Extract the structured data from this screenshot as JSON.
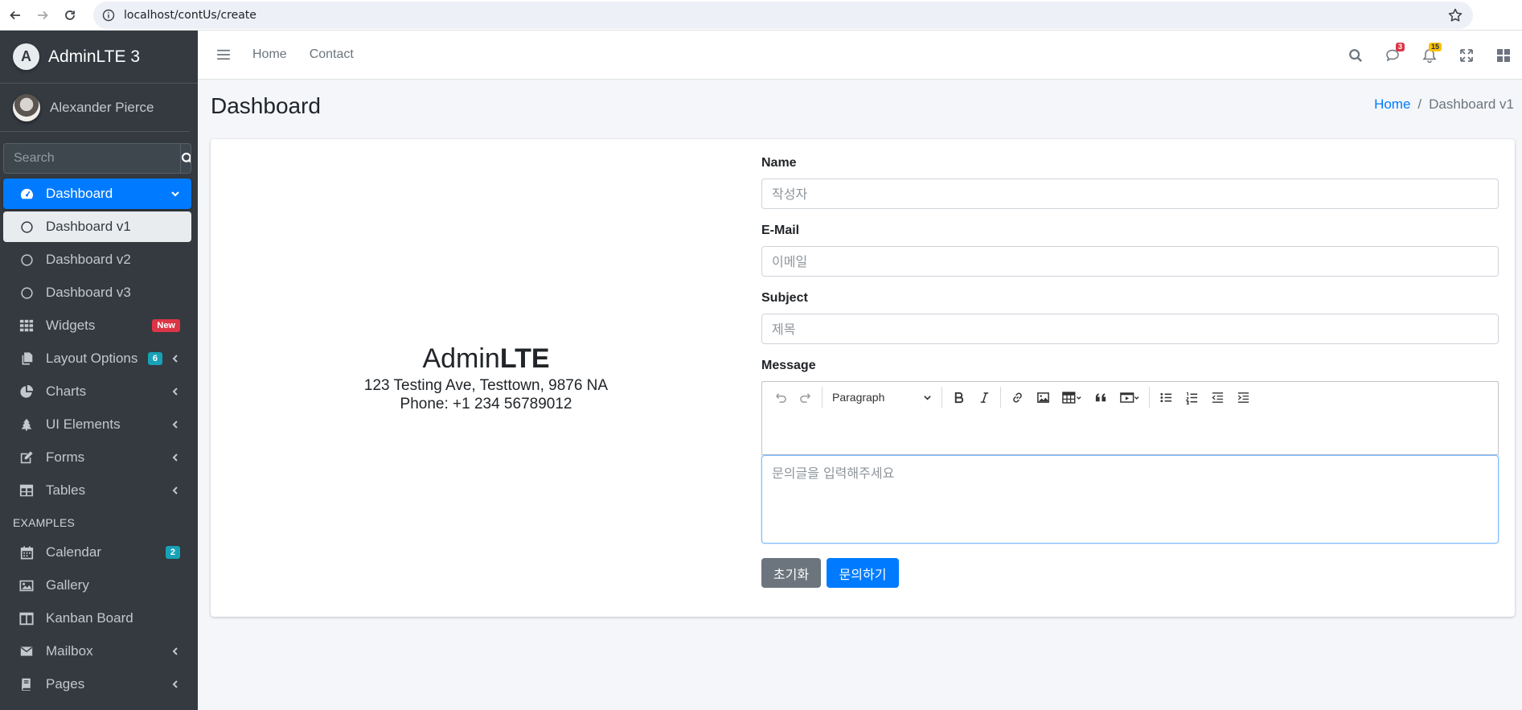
{
  "browser": {
    "url": "localhost/contUs/create"
  },
  "sidebar": {
    "brand": "AdminLTE 3",
    "brand_logo_letter": "A",
    "user_name": "Alexander Pierce",
    "search_placeholder": "Search",
    "items": [
      {
        "label": "Dashboard",
        "icon": "tachometer-icon",
        "state": "active"
      },
      {
        "label": "Dashboard v1",
        "icon": "circle-icon",
        "state": "sub-active"
      },
      {
        "label": "Dashboard v2",
        "icon": "circle-icon"
      },
      {
        "label": "Dashboard v3",
        "icon": "circle-icon"
      },
      {
        "label": "Widgets",
        "icon": "th-icon",
        "badge": "New"
      },
      {
        "label": "Layout Options",
        "icon": "copy-icon",
        "badge": "6"
      },
      {
        "label": "Charts",
        "icon": "chart-pie-icon"
      },
      {
        "label": "UI Elements",
        "icon": "tree-icon"
      },
      {
        "label": "Forms",
        "icon": "edit-icon"
      },
      {
        "label": "Tables",
        "icon": "table-icon"
      }
    ],
    "section_header": "EXAMPLES",
    "examples": [
      {
        "label": "Calendar",
        "icon": "calendar-icon",
        "badge": "2"
      },
      {
        "label": "Gallery",
        "icon": "image-icon"
      },
      {
        "label": "Kanban Board",
        "icon": "columns-icon"
      },
      {
        "label": "Mailbox",
        "icon": "envelope-icon"
      },
      {
        "label": "Pages",
        "icon": "book-icon"
      }
    ]
  },
  "navbar": {
    "links": [
      "Home",
      "Contact"
    ],
    "messages_count": "3",
    "notifications_count": "15"
  },
  "header": {
    "title": "Dashboard",
    "breadcrumb_home": "Home",
    "breadcrumb_sep": "/",
    "breadcrumb_current": "Dashboard v1"
  },
  "contact": {
    "company_light": "Admin",
    "company_bold": "LTE",
    "address": "123 Testing Ave, Testtown, 9876 NA",
    "phone": "Phone: +1 234 56789012"
  },
  "form": {
    "name_label": "Name",
    "name_placeholder": "작성자",
    "email_label": "E-Mail",
    "email_placeholder": "이메일",
    "subject_label": "Subject",
    "subject_placeholder": "제목",
    "message_label": "Message",
    "editor_paragraph": "Paragraph",
    "message_placeholder": "문의글을 입력해주세요",
    "reset_label": "초기화",
    "submit_label": "문의하기"
  },
  "colors": {
    "primary": "#007bff",
    "sidebar_bg": "#343a40",
    "danger": "#dc3545",
    "info": "#17a2b8",
    "warning": "#ffc107",
    "secondary": "#6c757d"
  }
}
